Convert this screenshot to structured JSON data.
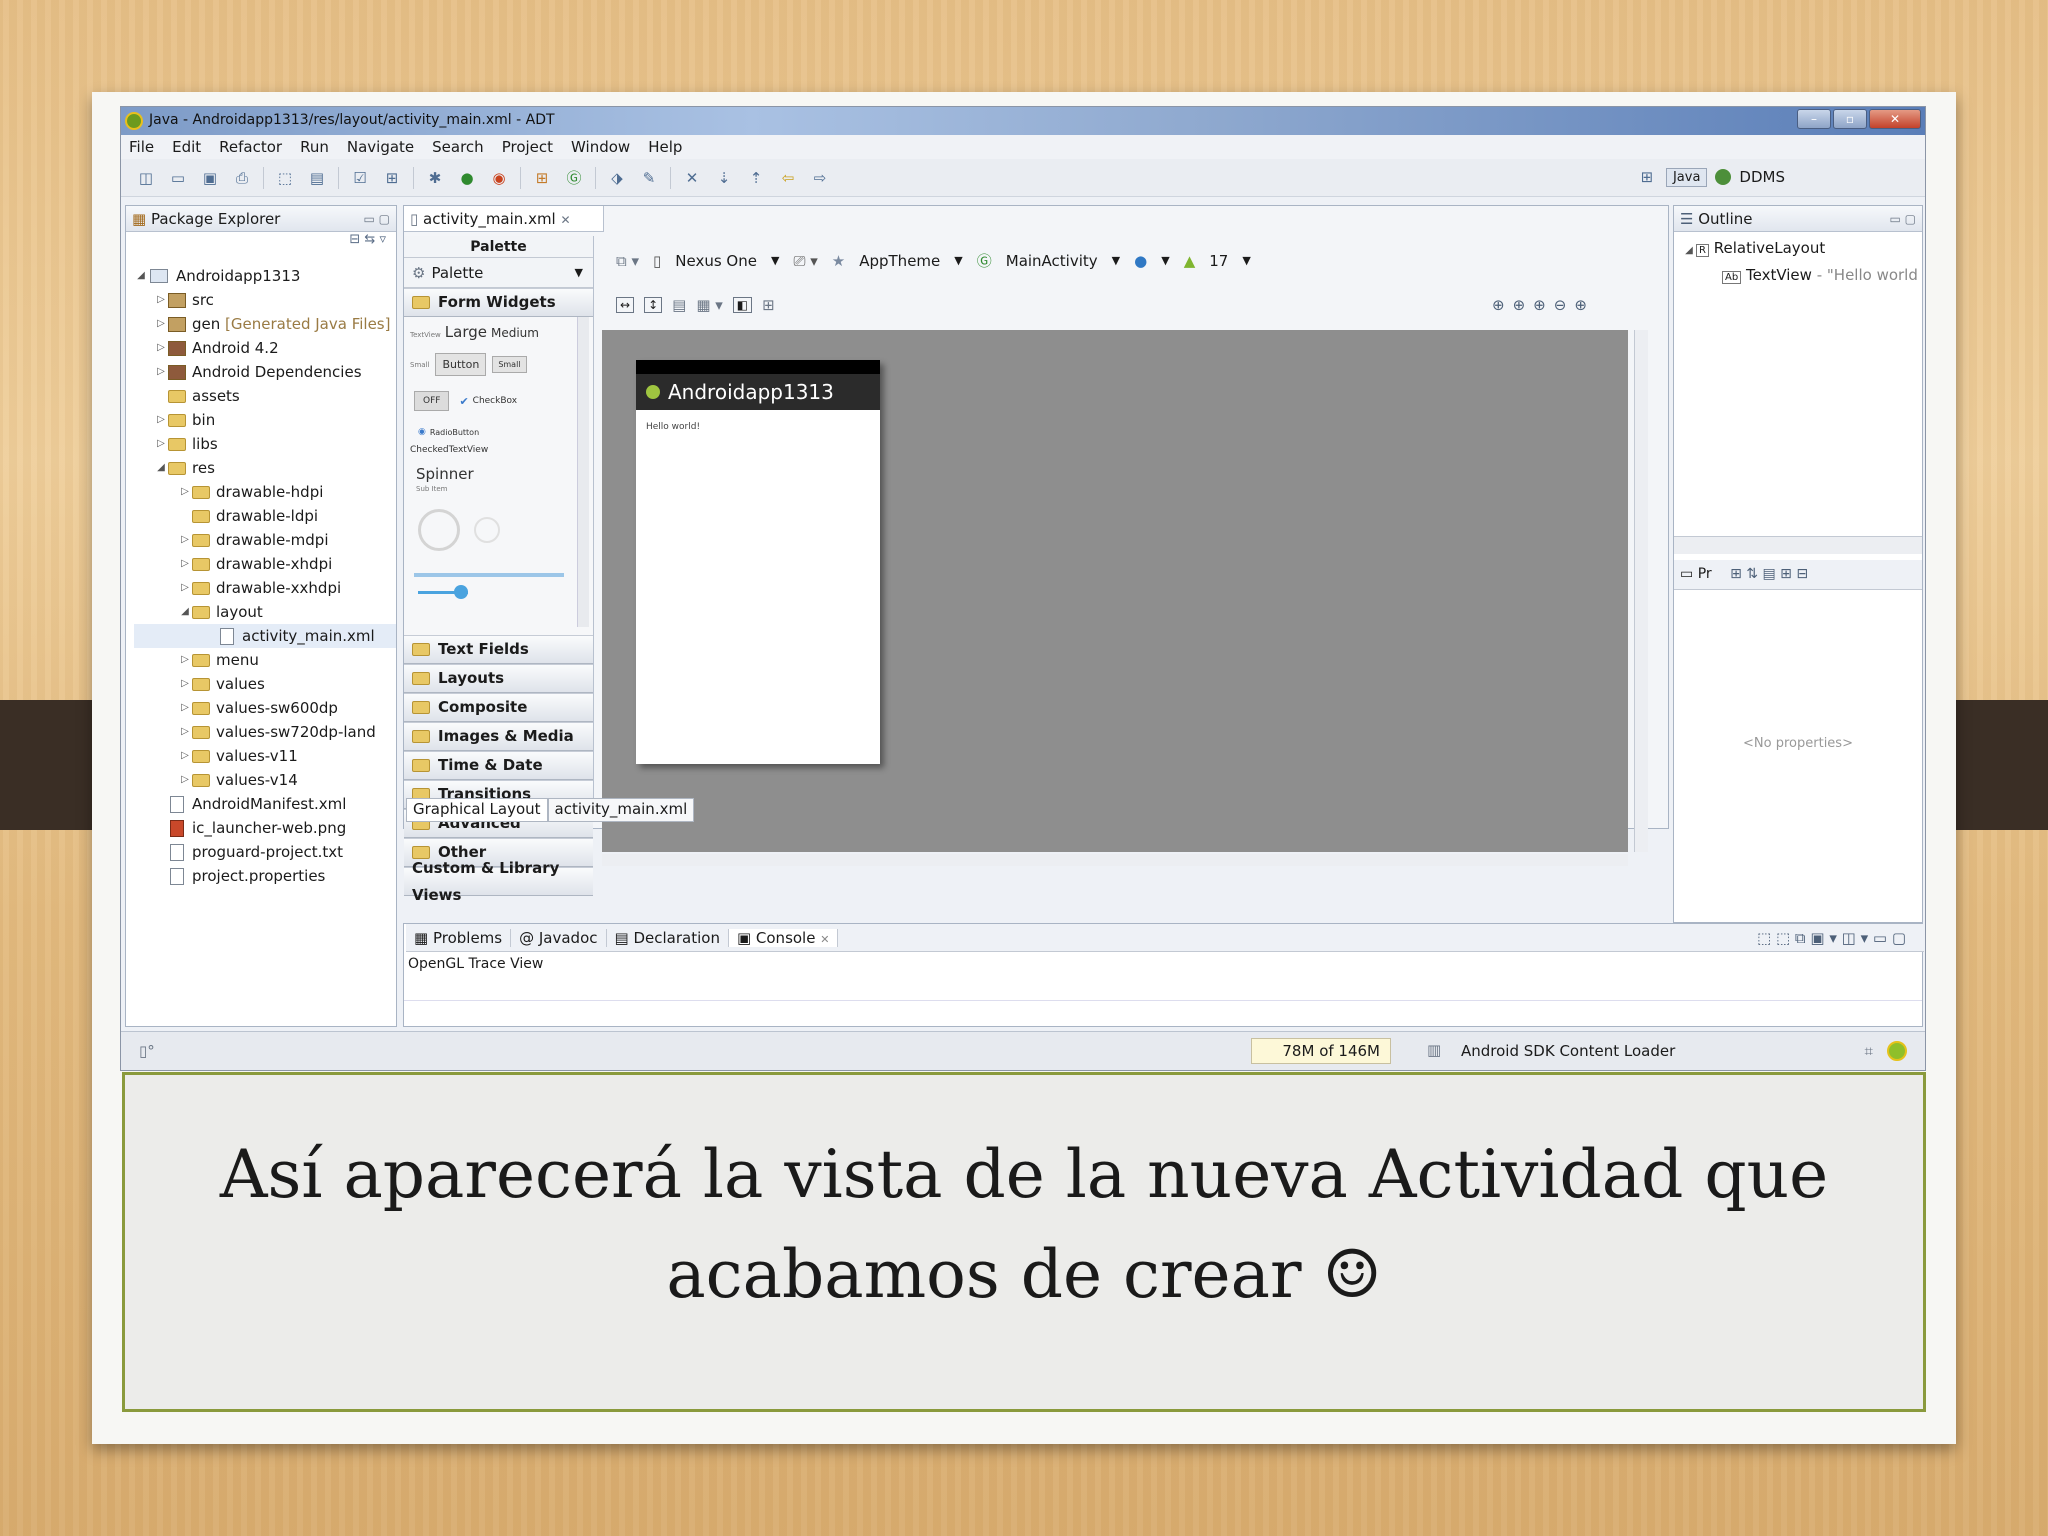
{
  "window": {
    "title": "Java - Androidapp1313/res/layout/activity_main.xml - ADT"
  },
  "menu": [
    "File",
    "Edit",
    "Refactor",
    "Run",
    "Navigate",
    "Search",
    "Project",
    "Window",
    "Help"
  ],
  "perspectives": {
    "java": "Java",
    "ddms": "DDMS"
  },
  "package_explorer": {
    "tab": "Package Explorer",
    "project": "Androidapp1313",
    "items": [
      {
        "label": "src",
        "icon": "package-folder-icon"
      },
      {
        "label": "gen",
        "note": "[Generated Java Files]",
        "icon": "package-folder-icon"
      },
      {
        "label": "Android 4.2",
        "icon": "library-icon"
      },
      {
        "label": "Android Dependencies",
        "icon": "library-icon"
      },
      {
        "label": "assets",
        "icon": "folder-icon"
      },
      {
        "label": "bin",
        "icon": "folder-icon"
      },
      {
        "label": "libs",
        "icon": "folder-icon"
      },
      {
        "label": "res",
        "icon": "folder-icon"
      },
      {
        "label": "drawable-hdpi",
        "icon": "folder-icon"
      },
      {
        "label": "drawable-ldpi",
        "icon": "folder-icon"
      },
      {
        "label": "drawable-mdpi",
        "icon": "folder-icon"
      },
      {
        "label": "drawable-xhdpi",
        "icon": "folder-icon"
      },
      {
        "label": "drawable-xxhdpi",
        "icon": "folder-icon"
      },
      {
        "label": "layout",
        "icon": "folder-icon"
      },
      {
        "label": "activity_main.xml",
        "icon": "xml-file-icon"
      },
      {
        "label": "menu",
        "icon": "folder-icon"
      },
      {
        "label": "values",
        "icon": "folder-icon"
      },
      {
        "label": "values-sw600dp",
        "icon": "folder-icon"
      },
      {
        "label": "values-sw720dp-land",
        "icon": "folder-icon"
      },
      {
        "label": "values-v11",
        "icon": "folder-icon"
      },
      {
        "label": "values-v14",
        "icon": "folder-icon"
      },
      {
        "label": "AndroidManifest.xml",
        "icon": "xml-file-icon"
      },
      {
        "label": "ic_launcher-web.png",
        "icon": "image-file-icon"
      },
      {
        "label": "proguard-project.txt",
        "icon": "text-file-icon"
      },
      {
        "label": "project.properties",
        "icon": "text-file-icon"
      }
    ]
  },
  "editor": {
    "tab": "activity_main.xml",
    "palette": {
      "header": "Palette",
      "dropdown": "Palette",
      "form_widgets": "Form Widgets",
      "widgets": {
        "textview": "TextView",
        "large": "Large",
        "medium": "Medium",
        "small": "Small",
        "button": "Button",
        "off": "OFF",
        "checkbox": "CheckBox",
        "radio": "RadioButton",
        "checked_textview": "CheckedTextView",
        "spinner": "Spinner",
        "sub_item": "Sub Item"
      },
      "categories": [
        "Text Fields",
        "Layouts",
        "Composite",
        "Images & Media",
        "Time & Date",
        "Transitions",
        "Advanced",
        "Other",
        "Custom & Library Views"
      ]
    },
    "config": {
      "device": "Nexus One",
      "theme": "AppTheme",
      "activity": "MainActivity",
      "api": "17"
    },
    "preview": {
      "app_title": "Androidapp1313",
      "hello": "Hello world!"
    },
    "bottom_tabs": [
      "Graphical Layout",
      "activity_main.xml"
    ]
  },
  "outline": {
    "tab": "Outline",
    "root": "RelativeLayout",
    "child": "TextView",
    "child_value": "- \"Hello world",
    "props_tab": "Pr",
    "no_properties": "<No properties>"
  },
  "console": {
    "tabs": [
      "Problems",
      "Javadoc",
      "Declaration",
      "Console"
    ],
    "view_name": "OpenGL Trace View"
  },
  "status": {
    "memory": "78M of 146M",
    "loader": "Android SDK Content Loader"
  },
  "caption": {
    "line1": "Así aparecerá la vista de la nueva Actividad que",
    "line2": "acabamos de crear ☺"
  }
}
